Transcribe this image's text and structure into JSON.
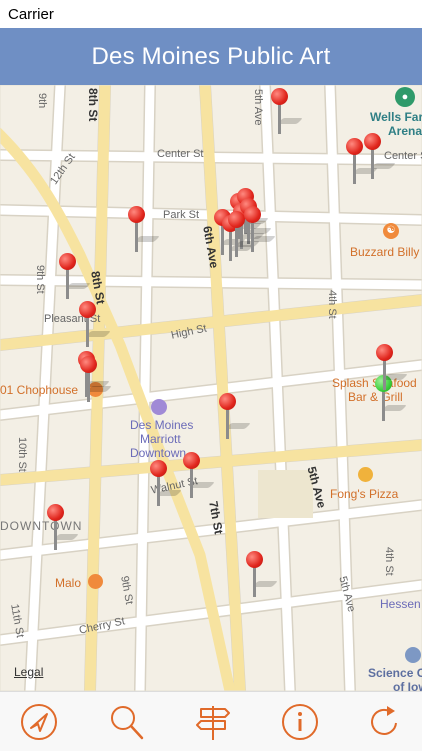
{
  "status": {
    "carrier": "Carrier"
  },
  "header": {
    "title": "Des Moines Public Art"
  },
  "map": {
    "streets": [
      "9th",
      "8th St",
      "5th Ave",
      "Center St",
      "Park St",
      "6th Ave",
      "12th St",
      "9th St",
      "8th St",
      "Pleasant St",
      "High St",
      "4th St",
      "10th St",
      "Walnut St",
      "7th St",
      "5th Ave",
      "9th St",
      "11th St",
      "Cherry St",
      "4th St",
      "5th Ave",
      "Center St"
    ],
    "places": {
      "wells_fargo_arena_line1": "Wells Far",
      "wells_fargo_arena_line2": "Arena",
      "buzzard_billys": "Buzzard Billy",
      "splash_line1": "Splash Seafood",
      "splash_line2": "Bar & Grill",
      "chophouse": "01 Chophouse",
      "marriott_line1": "Des Moines",
      "marriott_line2": "Marriott",
      "marriott_line3": "Downtown",
      "fongs_pizza": "Fong's Pizza",
      "downtown": "DOWNTOWN",
      "malo": "Malo",
      "hessen": "Hessen",
      "science_center_line1": "Science Ce",
      "science_center_line2": "of Iow"
    },
    "legal": "Legal",
    "pin_colors": {
      "red": "#e0251c",
      "green": "#3bcf3b"
    },
    "pins": [
      {
        "color": "red"
      },
      {
        "color": "red"
      },
      {
        "color": "red"
      },
      {
        "color": "red"
      },
      {
        "color": "red"
      },
      {
        "color": "red"
      },
      {
        "color": "red"
      },
      {
        "color": "red"
      },
      {
        "color": "red"
      },
      {
        "color": "red"
      },
      {
        "color": "red"
      },
      {
        "color": "red"
      },
      {
        "color": "red"
      },
      {
        "color": "red"
      },
      {
        "color": "red"
      },
      {
        "color": "red"
      },
      {
        "color": "red"
      },
      {
        "color": "red"
      },
      {
        "color": "red"
      },
      {
        "color": "red"
      },
      {
        "color": "red"
      },
      {
        "color": "green"
      },
      {
        "color": "red"
      }
    ]
  },
  "toolbar": {
    "accent": "#e06a2a",
    "items": [
      {
        "icon": "location-arrow-icon"
      },
      {
        "icon": "search-icon"
      },
      {
        "icon": "signpost-icon"
      },
      {
        "icon": "info-icon"
      },
      {
        "icon": "refresh-icon"
      }
    ]
  }
}
